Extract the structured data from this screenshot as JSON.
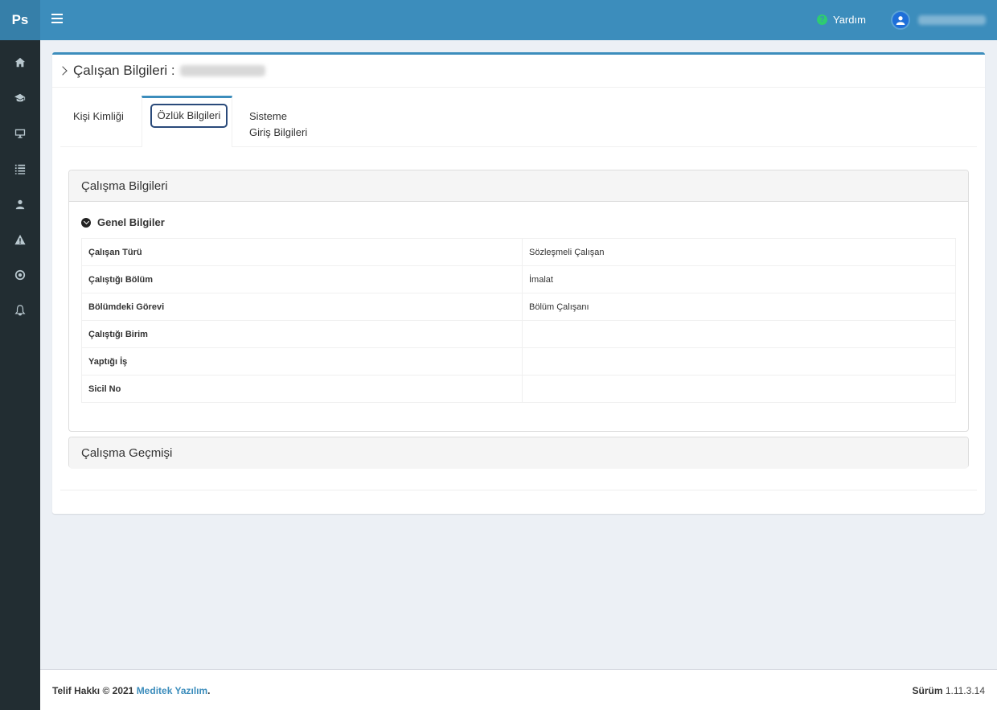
{
  "brand": {
    "logo_text": "Ps"
  },
  "sidebar": {
    "items": [
      {
        "icon": "home-icon"
      },
      {
        "icon": "graduation-cap-icon"
      },
      {
        "icon": "monitor-icon"
      },
      {
        "icon": "list-icon"
      },
      {
        "icon": "users-icon"
      },
      {
        "icon": "warning-icon"
      },
      {
        "icon": "target-icon"
      },
      {
        "icon": "bell-icon"
      }
    ]
  },
  "header": {
    "help_label": "Yardım",
    "help_icon": "question-circle-icon",
    "user_icon": "user-icon"
  },
  "page": {
    "title": "Çalışan Bilgileri :"
  },
  "tabs": [
    {
      "label": "Kişi Kimliği"
    },
    {
      "label": "Özlük Bilgileri"
    },
    {
      "label_line1": "Sisteme",
      "label_line2": "Giriş Bilgileri"
    }
  ],
  "work_info": {
    "panel_title": "Çalışma Bilgileri",
    "section_title": "Genel Bilgiler",
    "rows": [
      {
        "label": "Çalışan Türü",
        "value": "Sözleşmeli Çalışan"
      },
      {
        "label": "Çalıştığı Bölüm",
        "value": "İmalat"
      },
      {
        "label": "Bölümdeki Görevi",
        "value": "Bölüm Çalışanı"
      },
      {
        "label": "Çalıştığı Birim",
        "value": ""
      },
      {
        "label": "Yaptığı İş",
        "value": ""
      },
      {
        "label": "Sicil No",
        "value": ""
      }
    ]
  },
  "work_history": {
    "panel_title": "Çalışma Geçmişi"
  },
  "footer": {
    "copyright_prefix": "Telif Hakkı © 2021",
    "company": "Meditek Yazılım",
    "period": ".",
    "version_label": "Sürüm",
    "version": "1.11.3.14"
  },
  "colors": {
    "sidebar": "#222d32",
    "header": "#3c8dbc",
    "brand": "#367fa9",
    "help_dot": "#2ecc71"
  }
}
